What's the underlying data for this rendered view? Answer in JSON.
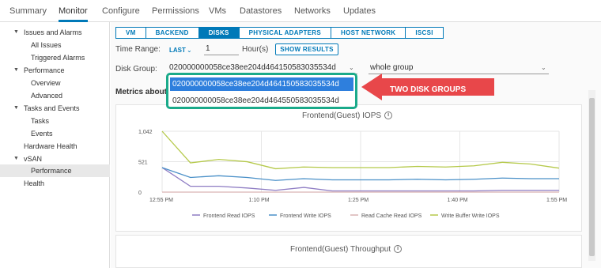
{
  "top_tabs": [
    "Summary",
    "Monitor",
    "Configure",
    "Permissions",
    "VMs",
    "Datastores",
    "Networks",
    "Updates"
  ],
  "sidebar": {
    "items": [
      {
        "label": "Issues and Alarms"
      },
      {
        "label": "All Issues"
      },
      {
        "label": "Triggered Alarms"
      },
      {
        "label": "Performance"
      },
      {
        "label": "Overview"
      },
      {
        "label": "Advanced"
      },
      {
        "label": "Tasks and Events"
      },
      {
        "label": "Tasks"
      },
      {
        "label": "Events"
      },
      {
        "label": "Hardware Health"
      },
      {
        "label": "vSAN"
      },
      {
        "label": "Performance"
      },
      {
        "label": "Health"
      }
    ]
  },
  "subtabs": [
    "VM",
    "BACKEND",
    "DISKS",
    "PHYSICAL ADAPTERS",
    "HOST NETWORK",
    "ISCSI"
  ],
  "time_range": {
    "label": "Time Range:",
    "mode": "LAST",
    "value": "1",
    "unit": "Hour(s)",
    "button": "SHOW RESULTS"
  },
  "disk_group": {
    "label": "Disk Group:",
    "selected": "020000000058ce38ee204d464150583035534d",
    "filter": "whole group"
  },
  "dropdown_options": [
    "020000000058ce38ee204d464150583035534d",
    "020000000058ce38ee204d464550583035534d"
  ],
  "metrics_label": "Metrics about",
  "callout_text": "TWO DISK GROUPS",
  "colors": {
    "accent": "#0079b8",
    "callout": "#e8474a",
    "highlight": "#1aaa8a"
  },
  "chart_data": {
    "type": "line",
    "title": "Frontend(Guest) IOPS",
    "x": [
      "12:55 PM",
      "",
      "",
      "1:10 PM",
      "",
      "",
      "",
      "1:25 PM",
      "",
      "",
      "",
      "1:40 PM",
      "",
      "",
      "1:55 PM"
    ],
    "x_ticks": [
      "12:55 PM",
      "1:10 PM",
      "1:25 PM",
      "1:40 PM",
      "1:55 PM"
    ],
    "y_ticks": [
      "1,042",
      "521",
      "0"
    ],
    "ylim": [
      0,
      1042
    ],
    "series": [
      {
        "name": "Frontend Read IOPS",
        "color": "#8e7cc3",
        "values": [
          420,
          100,
          100,
          70,
          30,
          80,
          20,
          20,
          20,
          20,
          20,
          20,
          30,
          30,
          30
        ]
      },
      {
        "name": "Frontend Write IOPS",
        "color": "#4a90c8",
        "values": [
          420,
          250,
          280,
          250,
          200,
          230,
          210,
          210,
          210,
          220,
          210,
          220,
          240,
          230,
          230
        ]
      },
      {
        "name": "Read Cache Read IOPS",
        "color": "#d9b3b3",
        "values": [
          0,
          0,
          0,
          0,
          0,
          0,
          0,
          0,
          0,
          0,
          0,
          0,
          0,
          0,
          0
        ]
      },
      {
        "name": "Write Buffer Write IOPS",
        "color": "#b5c94a",
        "values": [
          1042,
          500,
          560,
          520,
          400,
          430,
          420,
          420,
          420,
          440,
          430,
          450,
          510,
          480,
          410
        ]
      }
    ]
  },
  "second_chart_title": "Frontend(Guest) Throughput"
}
